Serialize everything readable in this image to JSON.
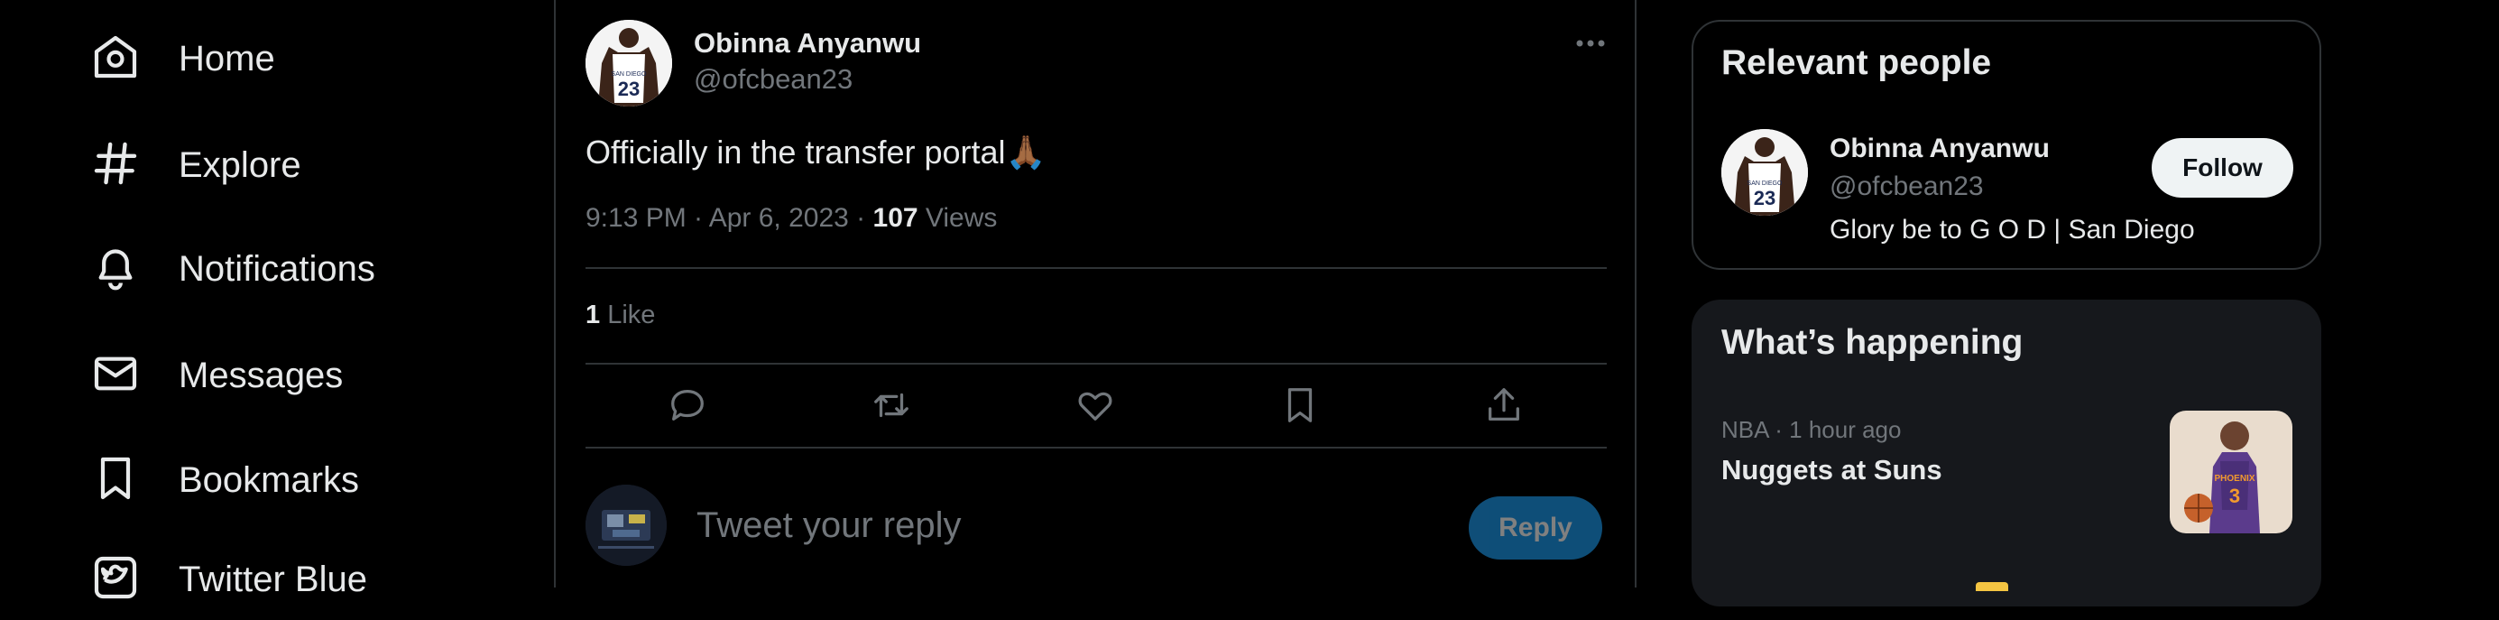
{
  "nav": {
    "items": [
      {
        "label": "Home",
        "icon": "home-icon"
      },
      {
        "label": "Explore",
        "icon": "hashtag-icon"
      },
      {
        "label": "Notifications",
        "icon": "bell-icon"
      },
      {
        "label": "Messages",
        "icon": "envelope-icon"
      },
      {
        "label": "Bookmarks",
        "icon": "bookmark-icon"
      },
      {
        "label": "Twitter Blue",
        "icon": "twitter-blue-icon"
      }
    ]
  },
  "tweet": {
    "author_name": "Obinna Anyanwu",
    "author_handle": "@ofcbean23",
    "text": "Officially in the transfer portal",
    "emoji": "🙏🏾",
    "meta": {
      "time": "9:13 PM · Apr 6, 2023 · ",
      "views_count": "107",
      "views_label": " Views"
    },
    "likes": {
      "count": "1",
      "label": " Like"
    },
    "jersey_number": "23",
    "actions": [
      "reply-icon",
      "retweet-icon",
      "like-icon",
      "bookmark-icon",
      "share-icon"
    ]
  },
  "reply_box": {
    "placeholder": "Tweet your reply",
    "button_label": "Reply"
  },
  "relevant_people": {
    "title": "Relevant people",
    "person": {
      "name": "Obinna Anyanwu",
      "handle": "@ofcbean23",
      "bio": "Glory be to G O D | San Diego",
      "follow_label": "Follow"
    }
  },
  "whats_happening": {
    "title": "What’s happening",
    "trend": {
      "meta": "NBA · 1 hour ago",
      "title": "Nuggets at Suns",
      "jersey_number": "3"
    }
  },
  "colors": {
    "accent": "#1d9bf0",
    "background": "#000000",
    "card": "#16181c",
    "divider": "#2f3336",
    "muted_text": "#71767b",
    "text": "#e7e9ea"
  }
}
